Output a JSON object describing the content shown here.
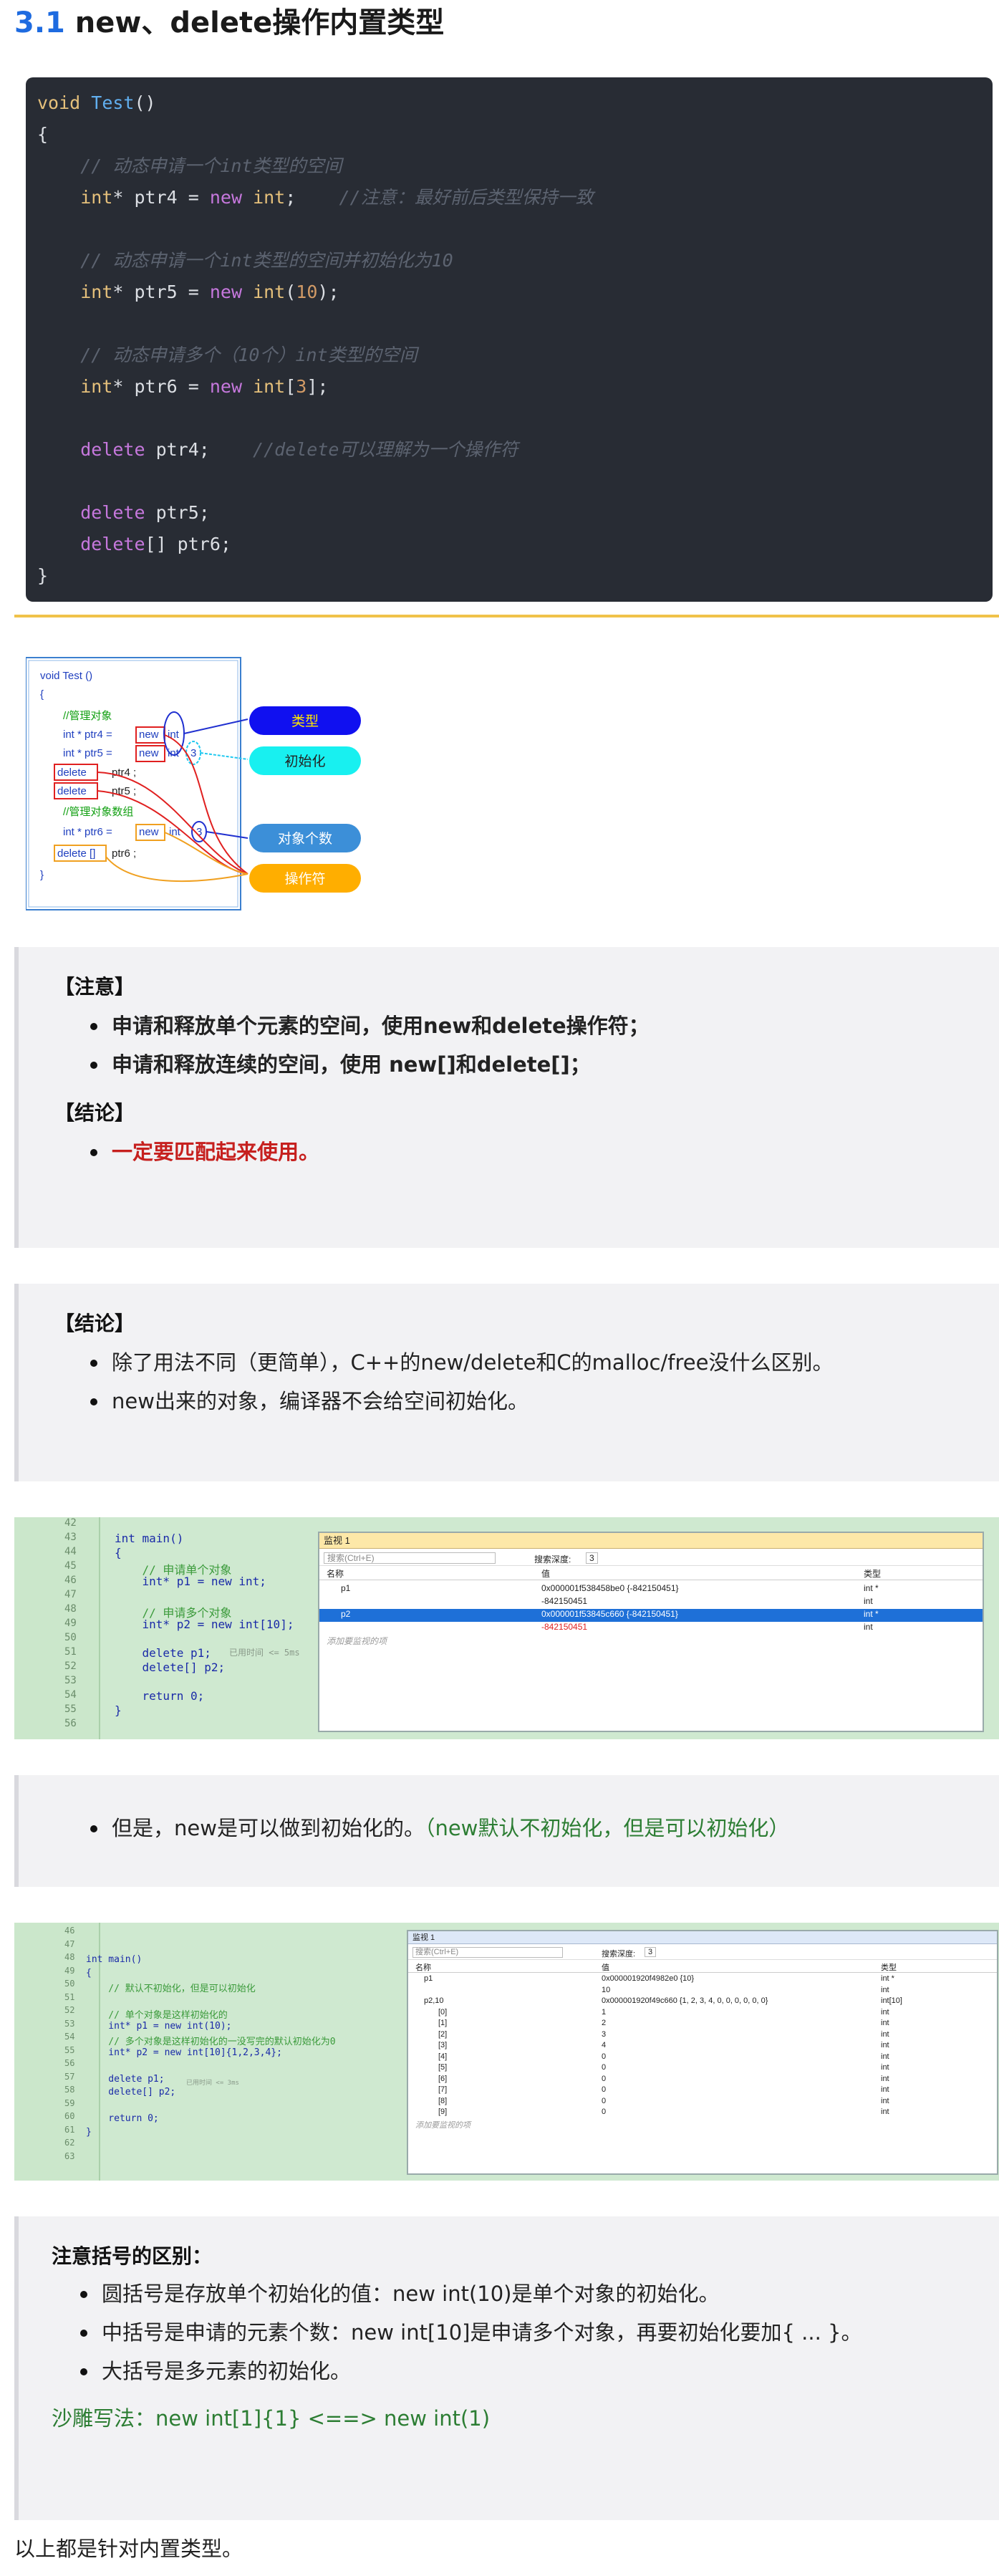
{
  "heading": {
    "number": "3.1",
    "title": "new、delete操作内置类型"
  },
  "code_lines": [
    [
      {
        "t": "void",
        "c": "ty"
      },
      {
        "t": " ",
        "c": "pl"
      },
      {
        "t": "Test",
        "c": "fn"
      },
      {
        "t": "()",
        "c": "pl"
      }
    ],
    [
      {
        "t": "{",
        "c": "pl"
      }
    ],
    [
      {
        "t": "    // 动态申请一个int类型的空间",
        "c": "cm"
      }
    ],
    [
      {
        "t": "    ",
        "c": "pl"
      },
      {
        "t": "int",
        "c": "ty"
      },
      {
        "t": "* ptr4 = ",
        "c": "pl"
      },
      {
        "t": "new",
        "c": "kw"
      },
      {
        "t": " ",
        "c": "pl"
      },
      {
        "t": "int",
        "c": "ty"
      },
      {
        "t": ";    ",
        "c": "pl"
      },
      {
        "t": "//注意：最好前后类型保持一致",
        "c": "cm"
      }
    ],
    [
      {
        "t": "",
        "c": "pl"
      }
    ],
    [
      {
        "t": "    // 动态申请一个int类型的空间并初始化为10",
        "c": "cm"
      }
    ],
    [
      {
        "t": "    ",
        "c": "pl"
      },
      {
        "t": "int",
        "c": "ty"
      },
      {
        "t": "* ptr5 = ",
        "c": "pl"
      },
      {
        "t": "new",
        "c": "kw"
      },
      {
        "t": " ",
        "c": "pl"
      },
      {
        "t": "int",
        "c": "ty"
      },
      {
        "t": "(",
        "c": "pl"
      },
      {
        "t": "10",
        "c": "nm"
      },
      {
        "t": ");",
        "c": "pl"
      }
    ],
    [
      {
        "t": "",
        "c": "pl"
      }
    ],
    [
      {
        "t": "    // 动态申请多个（10个）int类型的空间",
        "c": "cm"
      }
    ],
    [
      {
        "t": "    ",
        "c": "pl"
      },
      {
        "t": "int",
        "c": "ty"
      },
      {
        "t": "* ptr6 = ",
        "c": "pl"
      },
      {
        "t": "new",
        "c": "kw"
      },
      {
        "t": " ",
        "c": "pl"
      },
      {
        "t": "int",
        "c": "ty"
      },
      {
        "t": "[",
        "c": "pl"
      },
      {
        "t": "3",
        "c": "nm"
      },
      {
        "t": "];",
        "c": "pl"
      }
    ],
    [
      {
        "t": "",
        "c": "pl"
      }
    ],
    [
      {
        "t": "    ",
        "c": "pl"
      },
      {
        "t": "delete",
        "c": "kw"
      },
      {
        "t": " ptr4;    ",
        "c": "pl"
      },
      {
        "t": "//delete可以理解为一个操作符",
        "c": "cm"
      }
    ],
    [
      {
        "t": "",
        "c": "pl"
      }
    ],
    [
      {
        "t": "    ",
        "c": "pl"
      },
      {
        "t": "delete",
        "c": "kw"
      },
      {
        "t": " ptr5;",
        "c": "pl"
      }
    ],
    [
      {
        "t": "    ",
        "c": "pl"
      },
      {
        "t": "delete",
        "c": "kw"
      },
      {
        "t": "[] ptr6;",
        "c": "pl"
      }
    ],
    [
      {
        "t": "}",
        "c": "pl"
      }
    ]
  ],
  "diagram": {
    "code": [
      "void Test ()",
      "{",
      "//管理对象",
      "int * ptr4 =",
      "new",
      "int",
      "int * ptr5 =",
      "new",
      "int",
      "3",
      "delete",
      "ptr4 ;",
      "delete",
      "ptr5 ;",
      "//管理对象数组",
      "int * ptr6 =",
      "new",
      "int",
      "3",
      "delete []",
      "ptr6 ;",
      "}"
    ],
    "labels": [
      "类型",
      "初始化",
      "对象个数",
      "操作符"
    ],
    "label_colors": [
      "#1010f0",
      "#18f0f0",
      "#3c8fd8",
      "#ffae00"
    ]
  },
  "note1": {
    "title1": "【注意】",
    "items": [
      "申请和释放单个元素的空间，使用new和delete操作符；",
      "申请和释放连续的空间，使用 new[]和delete[]；"
    ],
    "title2": "【结论】",
    "conclusion": "一定要匹配起来使用。"
  },
  "note2": {
    "title": "【结论】",
    "items": [
      "除了用法不同（更简单），C++的new/delete和C的malloc/free没什么区别。",
      "new出来的对象，编译器不会给空间初始化。"
    ]
  },
  "shot1": {
    "line_numbers": [
      "42",
      "43",
      "44",
      "45",
      "46",
      "47",
      "48",
      "49",
      "50",
      "51",
      "52",
      "53",
      "54",
      "55",
      "56"
    ],
    "code": [
      "int main()",
      "{",
      "    // 申请单个对象",
      "    int* p1 = new int;",
      "",
      "    // 申请多个对象",
      "    int* p2 = new int[10];",
      "",
      "    delete p1;",
      "    delete[] p2;",
      "",
      "    return 0;",
      "}"
    ],
    "elapsed": "已用时间 <= 5ms",
    "watch": {
      "title": "监视 1",
      "search": "搜索(Ctrl+E)",
      "depth_label": "搜索深度:",
      "depth": "3",
      "cols": [
        "名称",
        "值",
        "类型"
      ],
      "rows": [
        [
          "p1",
          "0x000001f538458be0 {-842150451}",
          "int *"
        ],
        [
          "",
          "-842150451",
          "int"
        ],
        [
          "p2",
          "0x000001f53845c660 {-842150451}",
          "int *"
        ],
        [
          "",
          "-842150451",
          "int"
        ]
      ],
      "add": "添加要监视的项"
    }
  },
  "note3": {
    "text": "但是，new是可以做到初始化的。",
    "green": "（new默认不初始化，但是可以初始化）"
  },
  "shot2": {
    "line_numbers": [
      "46",
      "47",
      "48",
      "49",
      "50",
      "51",
      "52",
      "53",
      "54",
      "55",
      "56",
      "57",
      "58",
      "59",
      "60",
      "61",
      "62",
      "63"
    ],
    "code": [
      "int main()",
      "{",
      "    // 默认不初始化，但是可以初始化",
      "",
      "    // 单个对象是这样初始化的",
      "    int* p1 = new int(10);",
      "    // 多个对象是这样初始化的一没写完的默认初始化为0",
      "    int* p2 = new int[10]{1,2,3,4};",
      "",
      "    delete p1;",
      "    delete[] p2;",
      "",
      "    return 0;",
      "}"
    ],
    "elapsed": "已用时间 <= 3ms",
    "watch": {
      "title": "监视 1",
      "search": "搜索(Ctrl+E)",
      "depth_label": "搜索深度:",
      "depth": "3",
      "cols": [
        "名称",
        "值",
        "类型"
      ],
      "rows": [
        [
          "p1",
          "0x000001920f4982e0 {10}",
          "int *"
        ],
        [
          "",
          "10",
          "int"
        ],
        [
          "p2,10",
          "0x000001920f49c660 {1, 2, 3, 4, 0, 0, 0, 0, 0, 0}",
          "int[10]"
        ],
        [
          "[0]",
          "1",
          "int"
        ],
        [
          "[1]",
          "2",
          "int"
        ],
        [
          "[2]",
          "3",
          "int"
        ],
        [
          "[3]",
          "4",
          "int"
        ],
        [
          "[4]",
          "0",
          "int"
        ],
        [
          "[5]",
          "0",
          "int"
        ],
        [
          "[6]",
          "0",
          "int"
        ],
        [
          "[7]",
          "0",
          "int"
        ],
        [
          "[8]",
          "0",
          "int"
        ],
        [
          "[9]",
          "0",
          "int"
        ]
      ],
      "add": "添加要监视的项"
    }
  },
  "note4": {
    "title": "注意括号的区别：",
    "items": [
      "圆括号是存放单个初始化的值：new int(10)是单个对象的初始化。",
      "中括号是申请的元素个数：new int[10]是申请多个对象，再要初始化要加{ ... }。",
      "大括号是多元素的初始化。"
    ],
    "green": "沙雕写法：new int[1]{1}  <==> new int(1)"
  },
  "footer": "以上都是针对内置类型。"
}
